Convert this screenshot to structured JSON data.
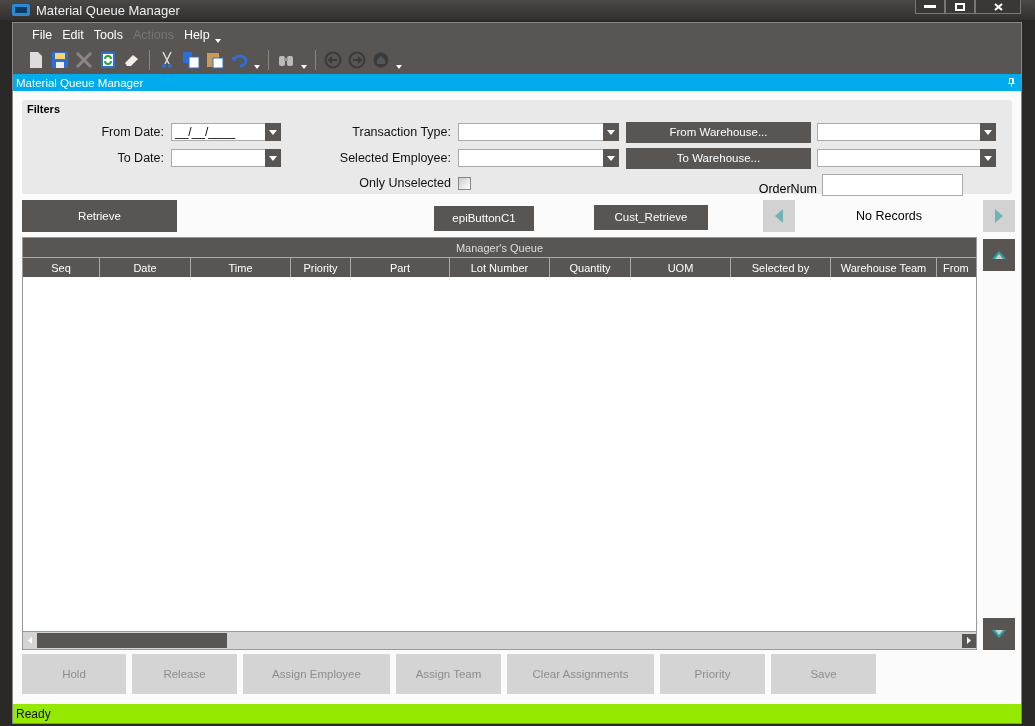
{
  "window": {
    "title": "Material Queue Manager"
  },
  "menu": [
    {
      "label": "File",
      "disabled": false
    },
    {
      "label": "Edit",
      "disabled": false
    },
    {
      "label": "Tools",
      "disabled": false
    },
    {
      "label": "Actions",
      "disabled": true
    },
    {
      "label": "Help",
      "disabled": false
    }
  ],
  "panel_title": "Material Queue Manager",
  "filters": {
    "title": "Filters",
    "from_date": {
      "label": "From Date:",
      "value": "__/__/____"
    },
    "to_date": {
      "label": "To Date:"
    },
    "transaction_type": {
      "label": "Transaction Type:"
    },
    "selected_employee": {
      "label": "Selected Employee:"
    },
    "only_unselected": {
      "label": "Only Unselected",
      "checked": false
    },
    "from_warehouse_button": "From Warehouse...",
    "to_warehouse_button": "To Warehouse...",
    "order_num": {
      "label": "OrderNum"
    }
  },
  "actions": {
    "retrieve": "Retrieve",
    "epi_button": "epiButtonC1",
    "cust_retrieve": "Cust_Retrieve",
    "record_status": "No Records"
  },
  "grid": {
    "title": "Manager's Queue",
    "columns": [
      "Seq",
      "Date",
      "Time",
      "Priority",
      "Part",
      "Lot Number",
      "Quantity",
      "UOM",
      "Selected by",
      "Warehouse Team",
      "From"
    ]
  },
  "buttons": [
    {
      "label": "Hold",
      "disabled": true
    },
    {
      "label": "Release",
      "disabled": true
    },
    {
      "label": "Assign Employee",
      "disabled": true
    },
    {
      "label": "Assign Team",
      "disabled": true
    },
    {
      "label": "Clear Assignments",
      "disabled": true
    },
    {
      "label": "Priority",
      "disabled": true
    },
    {
      "label": "Save",
      "disabled": true
    }
  ],
  "status_bar": "Ready"
}
